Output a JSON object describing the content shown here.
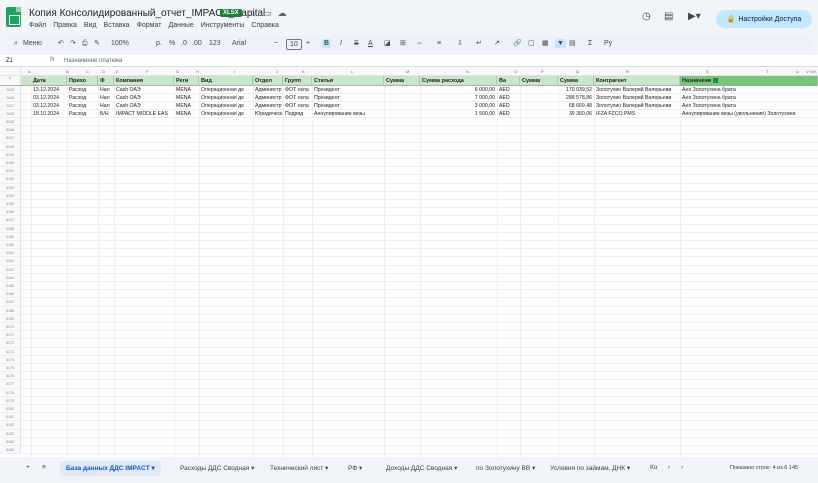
{
  "header": {
    "title": "Копия Консолидированный_отчет_IMPACT_Capital",
    "badge": "XLSX",
    "menus": [
      "Файл",
      "Правка",
      "Вид",
      "Вставка",
      "Формат",
      "Данные",
      "Инструменты",
      "Справка"
    ],
    "share_label": "Настройки Доступа"
  },
  "toolbar": {
    "menus_label": "Меню",
    "zoom": "100%",
    "currency": "р.",
    "percent": "%",
    "decimals_less": ".0",
    "decimals_more": ".00",
    "number_format": "123",
    "font": "Arial",
    "font_size": "10",
    "bold": "B",
    "italic": "I",
    "strike": "S",
    "text_color": "A"
  },
  "formula_bar": {
    "cell_ref": "Z1",
    "fx": "fx",
    "content": "Назначение платежа"
  },
  "columns": {
    "letters": [
      "A",
      "B",
      "C",
      "D",
      "E",
      "F",
      "G",
      "H",
      "I",
      "J",
      "K",
      "L",
      "M",
      "N",
      "O",
      "P",
      "Q",
      "R",
      "S",
      "T",
      "U",
      "V",
      "W",
      "X",
      "Y",
      "Z"
    ],
    "headers": [
      "Дата",
      "Прихо",
      "Ф",
      "Компания",
      "Реги",
      "Вид",
      "Отдел",
      "Групп",
      "Статья",
      "Сумма",
      "Сумма расхода",
      "Ва",
      "Сумма",
      "Сумма",
      "Контрагент",
      "Назначени"
    ]
  },
  "rows": [
    {
      "num": "2415",
      "cells": [
        "13.12.2024",
        "Расход",
        "Нал",
        "Cash ОАЭ",
        "MENA",
        "Операционная де",
        "Администр",
        "ФОТ окла",
        "Президент",
        "",
        "6 000,00",
        "AED",
        "",
        "170 039,52",
        "Золотухин Валерий Валерьеви",
        "Aня Золотухина брата"
      ]
    },
    {
      "num": "2416",
      "cells": [
        "03.12.2024",
        "Расход",
        "Нал",
        "Cash ОАЭ",
        "MENA",
        "Операционная де",
        "Администр",
        "ФОТ окла",
        "Президент",
        "",
        "7 000,00",
        "AED",
        "",
        "288 578,86",
        "Золотухин Валерий Валерьеви",
        "Aня Золотухина брата"
      ]
    },
    {
      "num": "2417",
      "cells": [
        "03.12.2024",
        "Расход",
        "Нал",
        "Cash ОАЭ",
        "MENA",
        "Операционная де",
        "Администр",
        "ФОТ окла",
        "Президент",
        "",
        "3 000,00",
        "AED",
        "",
        "68 669,48",
        "Золотухин Валерий Валерьеви",
        "Aня Золотухина брата"
      ]
    },
    {
      "num": "2418",
      "cells": [
        "18.10.2024",
        "Расход",
        "Б/Н",
        "IMPACT MIDDLE EAS",
        "MENA",
        "Операционная де",
        "Юридическ",
        "Подряд",
        "Аннулирование визы",
        "",
        "1 500,00",
        "AED",
        "",
        "39 360,06",
        "IFZA FZCO PMS",
        "Аннулирование визы (увольнение) Золотухина"
      ]
    }
  ],
  "empty_row_numbers": [
    "6145",
    "6146",
    "6147",
    "6148",
    "6149",
    "6150",
    "6151",
    "6152",
    "6153",
    "6154",
    "6155",
    "6156",
    "6157",
    "6158",
    "6159",
    "6160",
    "6161",
    "6162",
    "6163",
    "6164",
    "6165",
    "6166",
    "6167",
    "6168",
    "6169",
    "6170",
    "6171",
    "6172",
    "6173",
    "6174",
    "6175",
    "6176",
    "6177",
    "6178",
    "6179",
    "6180",
    "6181",
    "6182",
    "6183",
    "6184",
    "6185",
    "6186",
    "6187",
    "6188"
  ],
  "tabs": {
    "active": "База данных ДДС IMPACT",
    "others": [
      "Расходы ДДС Сводная",
      "Технический лист",
      "РФ",
      "Доходы ДДС Сводная",
      "по Золотухину ВВ",
      "Условия по займам, ДНК",
      "Ко"
    ],
    "status": "Показано строк: 4 из 6 145"
  }
}
